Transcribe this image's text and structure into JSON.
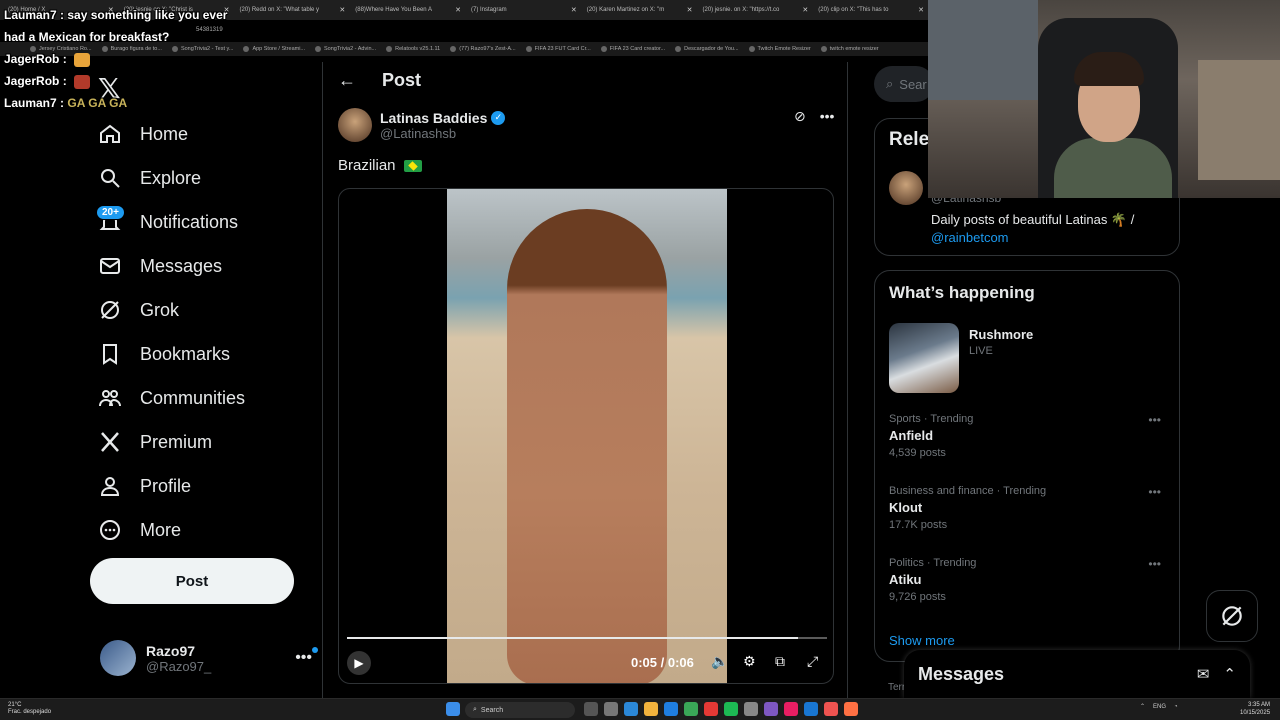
{
  "browser": {
    "tabs": [
      {
        "label": "(20) Home / X"
      },
      {
        "label": "(20) jesnie on X: \"Christ is"
      },
      {
        "label": "(20) Redd on X: \"What table y"
      },
      {
        "label": "(88)Where Have You Been A"
      },
      {
        "label": "(7) Instagram"
      },
      {
        "label": "(20) Karen Martinez on X: \"m"
      },
      {
        "label": "(20) jesnie. on X: \"https://t.co"
      },
      {
        "label": "(20) clip on X: \"This has to"
      }
    ],
    "url_fragment": "54381319",
    "bookmarks": [
      {
        "label": "Jersey Cristiano Ro..."
      },
      {
        "label": "Burago figura de to..."
      },
      {
        "label": "SongTrivia2 - Test y..."
      },
      {
        "label": "App Store / Streami..."
      },
      {
        "label": "SongTrivia2 - Advin..."
      },
      {
        "label": "Relatools v25.1.11"
      },
      {
        "label": "(77) Razo97's Zest-A..."
      },
      {
        "label": "FIFA 23 FUT Card Cr..."
      },
      {
        "label": "FIFA 23 Card creator..."
      },
      {
        "label": "Descargador de You..."
      },
      {
        "label": "Twitch Emote Resizer"
      },
      {
        "label": "twitch emote resizer"
      }
    ]
  },
  "chat": [
    {
      "user": "Lauman7",
      "message": "say something like you ever had a Mexican for breakfast?"
    },
    {
      "user": "JagerRob",
      "message": ""
    },
    {
      "user": "JagerRob",
      "message": ""
    },
    {
      "user": "Lauman7",
      "message": "GA GA GA"
    }
  ],
  "sidebar": {
    "items": [
      {
        "label": "Home",
        "icon": "home-icon"
      },
      {
        "label": "Explore",
        "icon": "search-icon"
      },
      {
        "label": "Notifications",
        "icon": "bell-icon"
      },
      {
        "label": "Messages",
        "icon": "mail-icon"
      },
      {
        "label": "Grok",
        "icon": "grok-icon"
      },
      {
        "label": "Bookmarks",
        "icon": "bookmark-icon"
      },
      {
        "label": "Communities",
        "icon": "people-icon"
      },
      {
        "label": "Premium",
        "icon": "x-icon"
      },
      {
        "label": "Profile",
        "icon": "person-icon"
      },
      {
        "label": "More",
        "icon": "more-circle-icon"
      }
    ],
    "notif_badge": "20+",
    "post_label": "Post",
    "profile": {
      "name": "Razo97",
      "handle": "@Razo97_"
    }
  },
  "post": {
    "header_title": "Post",
    "author_name": "Latinas Baddies",
    "author_handle": "@Latinashsb",
    "text": "Brazilian",
    "video": {
      "time": "0:05 / 0:06",
      "progress": 0.94
    }
  },
  "right": {
    "search_placeholder": "Sear",
    "relevant": {
      "title": "Rele",
      "handle": "@Latinashsb",
      "bio": "Daily posts of beautiful Latinas 🌴 /",
      "bio_link": "@rainbetcom"
    },
    "happening": {
      "title": "What’s happening",
      "live_title": "Rushmore",
      "live_label": "LIVE",
      "trends": [
        {
          "category": "Sports · Trending",
          "name": "Anfield",
          "count": "4,539 posts"
        },
        {
          "category": "Business and finance · Trending",
          "name": "Klout",
          "count": "17.7K posts"
        },
        {
          "category": "Politics · Trending",
          "name": "Atiku",
          "count": "9,726 posts"
        }
      ],
      "show_more": "Show more"
    },
    "terms": "Terr",
    "messages_title": "Messages"
  },
  "taskbar": {
    "weather_temp": "21°C",
    "weather_desc": "Frac. despejado",
    "search_label": "Search",
    "lang": "ENG",
    "time": "3:35 AM",
    "date": "10/15/2025"
  }
}
